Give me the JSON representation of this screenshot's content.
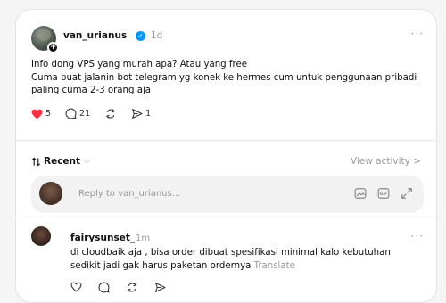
{
  "post": {
    "username": "van_urianus",
    "time": "1d",
    "text": "Info dong VPS yang murah apa? Atau yang free\nCuma buat jalanin bot telegram yg konek ke hermes cum untuk penggunaan pribadi paling cuma 2-3 orang aja",
    "likes": "5",
    "comments": "21",
    "shares": "1",
    "more_label": "···"
  },
  "sort": {
    "label": "Recent",
    "view_activity": "View activity >"
  },
  "reply": {
    "placeholder": "Reply to van_urianus..."
  },
  "comment": {
    "username": "fairysunset_",
    "time": "1m",
    "text": "di cloudbaik aja , bisa order dibuat spesifikasi minimal kalo kebutuhan sedikit jadi gak harus paketan ordernya",
    "translate_label": "Translate",
    "more_label": "···"
  },
  "colors": {
    "like_red": "#ff3040",
    "verified_blue": "#0095f6",
    "muted": "#999999"
  },
  "icons": [
    "plus-icon",
    "verified-icon",
    "heart-icon",
    "comment-icon",
    "repost-icon",
    "share-icon",
    "sort-icon",
    "chevron-down-icon",
    "gif-icon",
    "image-icon",
    "expand-icon"
  ]
}
